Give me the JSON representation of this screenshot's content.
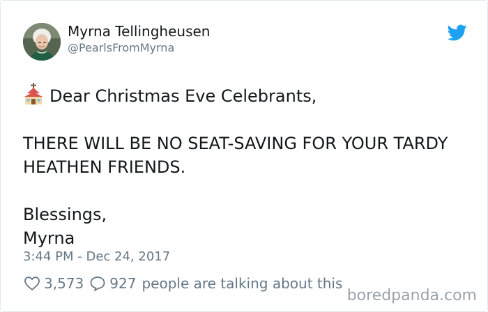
{
  "author": {
    "display_name": "Myrna Tellingheusen",
    "handle": "@PearlsFromMyrna"
  },
  "tweet": {
    "lines": [
      "Dear Christmas Eve Celebrants,",
      "",
      "THERE WILL BE NO SEAT-SAVING FOR YOUR TARDY",
      "HEATHEN FRIENDS.",
      "",
      "Blessings,",
      "Myrna"
    ],
    "emoji_icon": "church-icon"
  },
  "timestamp": "3:44 PM - Dec 24, 2017",
  "engagement": {
    "likes": "3,573",
    "replies": "927",
    "talking_text": "people are talking about this"
  },
  "watermark": "boredpanda.com",
  "colors": {
    "text": "#14171a",
    "secondary_text": "#657786",
    "twitter_blue": "#1da1f2",
    "card_border": "#e1e8ed",
    "watermark": "#9aa3ab"
  },
  "icons": [
    "twitter-bird-icon",
    "church-icon",
    "heart-icon",
    "reply-bubble-icon"
  ]
}
